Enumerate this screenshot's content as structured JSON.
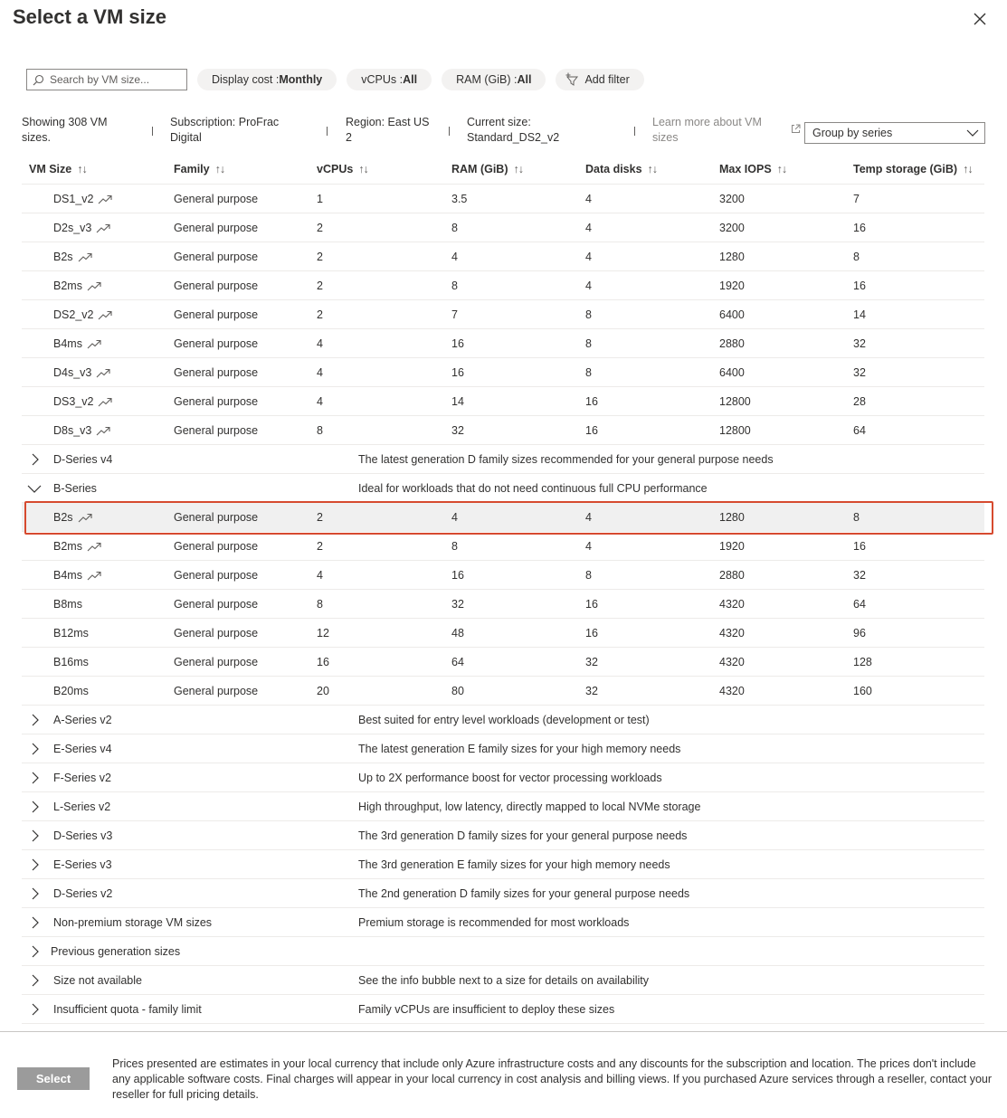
{
  "title": "Select a VM size",
  "toolbar": {
    "search_placeholder": "Search by VM size...",
    "display_cost_label": "Display cost : ",
    "display_cost_value": "Monthly",
    "vcpus_label": "vCPUs : ",
    "vcpus_value": "All",
    "ram_label": "RAM (GiB) : ",
    "ram_value": "All",
    "add_filter": "Add filter"
  },
  "info": {
    "showing_line1": "Showing 308 VM",
    "showing_line2": "sizes.",
    "subscription_line1": "Subscription: ProFrac",
    "subscription_line2": "Digital",
    "region_line1": "Region: East US",
    "region_line2": "2",
    "current_line1": "Current size:",
    "current_line2": "Standard_DS2_v2",
    "learn_line1": "Learn more about VM",
    "learn_line2": "sizes",
    "group_by": "Group by series"
  },
  "columns": {
    "size": "VM Size",
    "family": "Family",
    "vcpus": "vCPUs",
    "ram": "RAM (GiB)",
    "disks": "Data disks",
    "iops": "Max IOPS",
    "temp": "Temp storage (GiB)",
    "sort_glyph": "↑↓"
  },
  "recommended": [
    {
      "size": "DS1_v2",
      "family": "General purpose",
      "vcpus": "1",
      "ram": "3.5",
      "disks": "4",
      "iops": "3200",
      "temp": "7"
    },
    {
      "size": "D2s_v3",
      "family": "General purpose",
      "vcpus": "2",
      "ram": "8",
      "disks": "4",
      "iops": "3200",
      "temp": "16"
    },
    {
      "size": "B2s",
      "family": "General purpose",
      "vcpus": "2",
      "ram": "4",
      "disks": "4",
      "iops": "1280",
      "temp": "8"
    },
    {
      "size": "B2ms",
      "family": "General purpose",
      "vcpus": "2",
      "ram": "8",
      "disks": "4",
      "iops": "1920",
      "temp": "16"
    },
    {
      "size": "DS2_v2",
      "family": "General purpose",
      "vcpus": "2",
      "ram": "7",
      "disks": "8",
      "iops": "6400",
      "temp": "14"
    },
    {
      "size": "B4ms",
      "family": "General purpose",
      "vcpus": "4",
      "ram": "16",
      "disks": "8",
      "iops": "2880",
      "temp": "32"
    },
    {
      "size": "D4s_v3",
      "family": "General purpose",
      "vcpus": "4",
      "ram": "16",
      "disks": "8",
      "iops": "6400",
      "temp": "32"
    },
    {
      "size": "DS3_v2",
      "family": "General purpose",
      "vcpus": "4",
      "ram": "14",
      "disks": "16",
      "iops": "12800",
      "temp": "28"
    },
    {
      "size": "D8s_v3",
      "family": "General purpose",
      "vcpus": "8",
      "ram": "32",
      "disks": "16",
      "iops": "12800",
      "temp": "64"
    }
  ],
  "groups_before": [
    {
      "name": "D-Series v4",
      "desc": "The latest generation D family sizes recommended for your general purpose needs"
    }
  ],
  "b_series": {
    "name": "B-Series",
    "desc": "Ideal for workloads that do not need continuous full CPU performance",
    "rows": [
      {
        "size": "B2s",
        "family": "General purpose",
        "vcpus": "2",
        "ram": "4",
        "disks": "4",
        "iops": "1280",
        "temp": "8"
      },
      {
        "size": "B2ms",
        "family": "General purpose",
        "vcpus": "2",
        "ram": "8",
        "disks": "4",
        "iops": "1920",
        "temp": "16"
      },
      {
        "size": "B4ms",
        "family": "General purpose",
        "vcpus": "4",
        "ram": "16",
        "disks": "8",
        "iops": "2880",
        "temp": "32"
      },
      {
        "size": "B8ms",
        "family": "General purpose",
        "vcpus": "8",
        "ram": "32",
        "disks": "16",
        "iops": "4320",
        "temp": "64"
      },
      {
        "size": "B12ms",
        "family": "General purpose",
        "vcpus": "12",
        "ram": "48",
        "disks": "16",
        "iops": "4320",
        "temp": "96"
      },
      {
        "size": "B16ms",
        "family": "General purpose",
        "vcpus": "16",
        "ram": "64",
        "disks": "32",
        "iops": "4320",
        "temp": "128"
      },
      {
        "size": "B20ms",
        "family": "General purpose",
        "vcpus": "20",
        "ram": "80",
        "disks": "32",
        "iops": "4320",
        "temp": "160"
      }
    ]
  },
  "groups_after": [
    {
      "name": "A-Series v2",
      "desc": "Best suited for entry level workloads (development or test)"
    },
    {
      "name": "E-Series v4",
      "desc": "The latest generation E family sizes for your high memory needs"
    },
    {
      "name": "F-Series v2",
      "desc": "Up to 2X performance boost for vector processing workloads"
    },
    {
      "name": "L-Series v2",
      "desc": "High throughput, low latency, directly mapped to local NVMe storage"
    },
    {
      "name": "D-Series v3",
      "desc": "The 3rd generation D family sizes for your general purpose needs"
    },
    {
      "name": "E-Series v3",
      "desc": "The 3rd generation E family sizes for your high memory needs"
    },
    {
      "name": "D-Series v2",
      "desc": "The 2nd generation D family sizes for your general purpose needs"
    },
    {
      "name": "Non-premium storage VM sizes",
      "desc": "Premium storage is recommended for most workloads"
    },
    {
      "name": "Previous generation sizes",
      "desc": ""
    },
    {
      "name": "Size not available",
      "desc": "See the info bubble next to a size for details on availability"
    },
    {
      "name": "Insufficient quota - family limit",
      "desc": "Family vCPUs are insufficient to deploy these sizes"
    }
  ],
  "footer": {
    "select_label": "Select",
    "disclaimer": "Prices presented are estimates in your local currency that include only Azure infrastructure costs and any discounts for the subscription and location. The prices don't include any applicable software costs. Final charges will appear in your local currency in cost analysis and billing views. If you purchased Azure services through a reseller, contact your reseller for full pricing details."
  },
  "colors": {
    "highlight_border": "#d64a2f",
    "select_button": "#9b9b9b",
    "pill_bg": "#f3f2f1"
  }
}
